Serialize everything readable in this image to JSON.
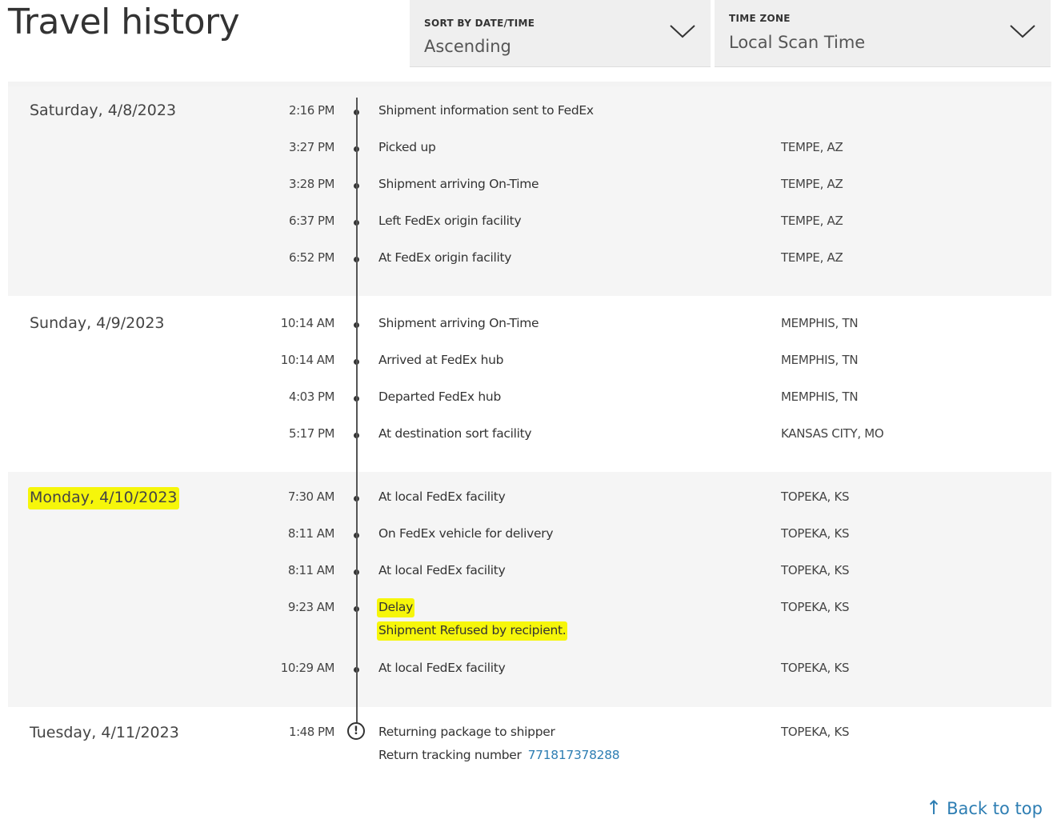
{
  "header": {
    "title": "Travel history",
    "sort": {
      "label": "SORT BY DATE/TIME",
      "value": "Ascending"
    },
    "timezone": {
      "label": "TIME ZONE",
      "value": "Local Scan Time"
    }
  },
  "days": [
    {
      "date": "Saturday, 4/8/2023",
      "events": [
        {
          "time": "2:16 PM",
          "description": "Shipment information sent to FedEx",
          "location": ""
        },
        {
          "time": "3:27 PM",
          "description": "Picked up",
          "location": "TEMPE, AZ"
        },
        {
          "time": "3:28 PM",
          "description": "Shipment arriving On-Time",
          "location": "TEMPE, AZ"
        },
        {
          "time": "6:37 PM",
          "description": "Left FedEx origin facility",
          "location": "TEMPE, AZ"
        },
        {
          "time": "6:52 PM",
          "description": "At FedEx origin facility",
          "location": "TEMPE, AZ"
        }
      ]
    },
    {
      "date": "Sunday, 4/9/2023",
      "events": [
        {
          "time": "10:14 AM",
          "description": "Shipment arriving On-Time",
          "location": "MEMPHIS, TN"
        },
        {
          "time": "10:14 AM",
          "description": "Arrived at FedEx hub",
          "location": "MEMPHIS, TN"
        },
        {
          "time": "4:03 PM",
          "description": "Departed FedEx hub",
          "location": "MEMPHIS, TN"
        },
        {
          "time": "5:17 PM",
          "description": "At destination sort facility",
          "location": "KANSAS CITY, MO"
        }
      ]
    },
    {
      "date": "Monday, 4/10/2023",
      "events": [
        {
          "time": "7:30 AM",
          "description": "At local FedEx facility",
          "location": "TOPEKA, KS"
        },
        {
          "time": "8:11 AM",
          "description": "On FedEx vehicle for delivery",
          "location": "TOPEKA, KS"
        },
        {
          "time": "8:11 AM",
          "description": "At local FedEx facility",
          "location": "TOPEKA, KS"
        },
        {
          "time": "9:23 AM",
          "description": "Delay",
          "detail": "Shipment Refused by recipient.",
          "location": "TOPEKA, KS"
        },
        {
          "time": "10:29 AM",
          "description": "At local FedEx facility",
          "location": "TOPEKA, KS"
        }
      ]
    },
    {
      "date": "Tuesday, 4/11/2023",
      "events": [
        {
          "time": "1:48 PM",
          "description": "Returning package to shipper",
          "detail_label": "Return tracking number",
          "detail_link": "771817378288",
          "location": "TOPEKA, KS"
        }
      ]
    }
  ],
  "end_marker_glyph": "!",
  "back_to_top": {
    "arrow": "↑",
    "label": "Back to top"
  },
  "colors": {
    "highlight": "#f6f60a",
    "link": "#2e7eb3",
    "shaded_row": "#f5f5f5"
  }
}
